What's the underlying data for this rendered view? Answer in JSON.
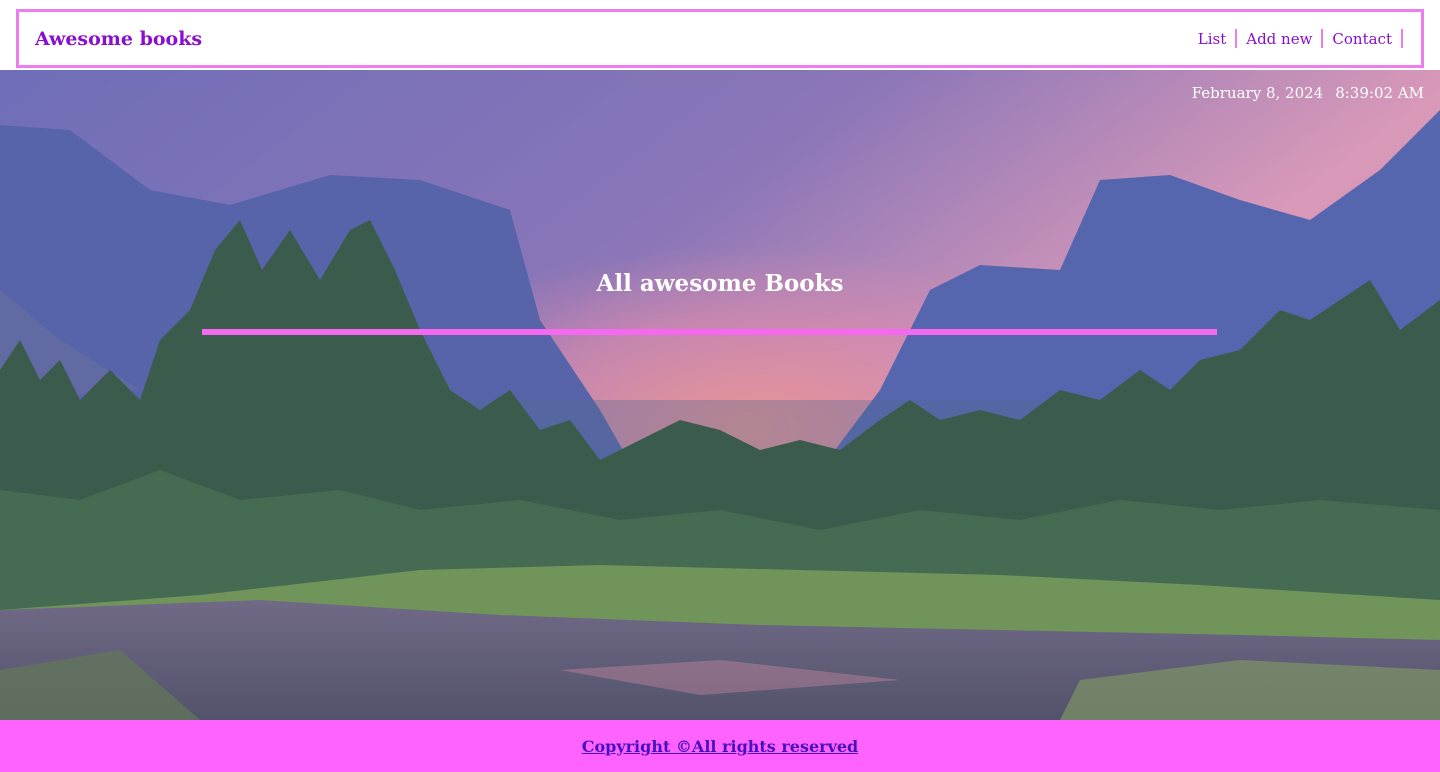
{
  "header": {
    "brand": "Awesome books",
    "nav": [
      {
        "label": "List"
      },
      {
        "label": "Add new"
      },
      {
        "label": "Contact"
      }
    ]
  },
  "hero": {
    "date": "February 8, 2024",
    "time": "8:39:02 AM",
    "title": "All awesome Books"
  },
  "footer": {
    "copyright": "Copyright ©All rights reserved"
  },
  "colors": {
    "accent": "#f07df0",
    "brand_text": "#8a0ecf",
    "footer_bg": "#ff63ff",
    "footer_link": "#4a0fc0"
  }
}
